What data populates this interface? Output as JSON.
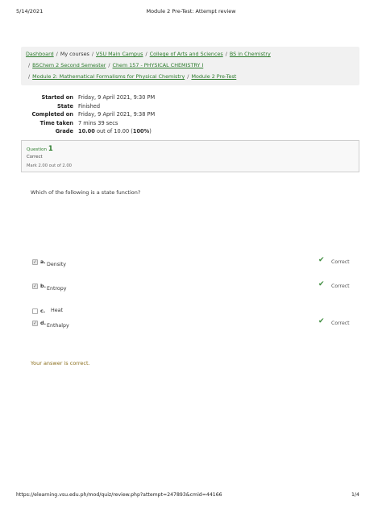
{
  "header": {
    "date": "5/14/2021",
    "title": "Module 2 Pre-Test: Attempt review"
  },
  "breadcrumb": {
    "row1": [
      "Dashboard",
      "My courses",
      "VSU Main Campus",
      "College of Arts and Sciences",
      "BS in Chemistry"
    ],
    "row2": [
      "BSChem 2 Second Semester",
      "Chem 157 - PHYSICAL CHEMISTRY I"
    ],
    "row3": [
      "Module 2: Mathematical Formalisms for Physical Chemistry",
      "Module 2 Pre-Test"
    ],
    "separator": "/"
  },
  "summary": {
    "started_label": "Started on",
    "started_value": "Friday, 9 April 2021, 9:30 PM",
    "state_label": "State",
    "state_value": "Finished",
    "completed_label": "Completed on",
    "completed_value": "Friday, 9 April 2021, 9:38 PM",
    "time_label": "Time taken",
    "time_value": "7 mins 39 secs",
    "grade_label": "Grade",
    "grade_score": "10.00",
    "grade_rest": " out of 10.00 (",
    "grade_percent": "100%",
    "grade_close": ")"
  },
  "question": {
    "label": "Question",
    "number": "1",
    "state": "Correct",
    "mark": "Mark 2.00 out of 2.00",
    "text": "Which of the following is a state function?",
    "answers": [
      {
        "letter": "a.",
        "text": "Density",
        "checked": true,
        "feedback": "Correct"
      },
      {
        "letter": "b.",
        "text": "Entropy",
        "checked": true,
        "feedback": "Correct"
      },
      {
        "letter": "c.",
        "text": "Heat",
        "checked": false,
        "feedback": ""
      },
      {
        "letter": "d.",
        "text": "Enthalpy",
        "checked": true,
        "feedback": "Correct"
      }
    ],
    "feedback": "Your answer is correct."
  },
  "footer": {
    "url": "https://elearning.vsu.edu.ph/mod/quiz/review.php?attempt=247893&cmid=44166",
    "page": "1/4"
  }
}
